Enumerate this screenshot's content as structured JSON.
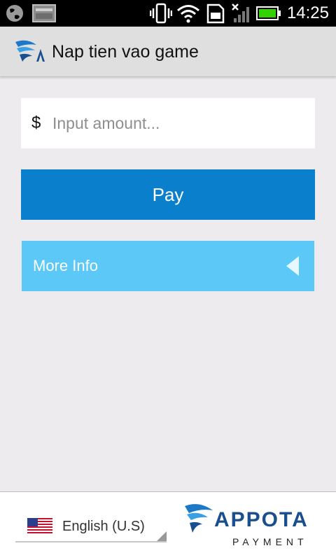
{
  "status_bar": {
    "time": "14:25",
    "icons": [
      "globe-icon",
      "image-icon",
      "vibrate-icon",
      "wifi-icon",
      "sd-card-icon",
      "signal-icon",
      "battery-icon"
    ]
  },
  "action_bar": {
    "title": "Nap tien vao game",
    "logo_icon": "appota-logo-icon"
  },
  "amount": {
    "currency_symbol": "$",
    "placeholder": "Input amount...",
    "value": ""
  },
  "pay_button": {
    "label": "Pay"
  },
  "more_info": {
    "label": "More Info",
    "icon": "triangle-left-icon"
  },
  "footer": {
    "language": {
      "selected": "English (U.S)",
      "flag_icon": "us-flag-icon"
    },
    "brand": {
      "name": "APPOTA",
      "sub": "PAYMENT"
    }
  },
  "colors": {
    "status_bar": "#000000",
    "action_bar": "#dfdfdf",
    "background": "#edebed",
    "pay_button": "#0a7fcb",
    "more_info": "#5bc8f7",
    "brand_blue": "#1a4f8f",
    "battery_green": "#32d100"
  }
}
